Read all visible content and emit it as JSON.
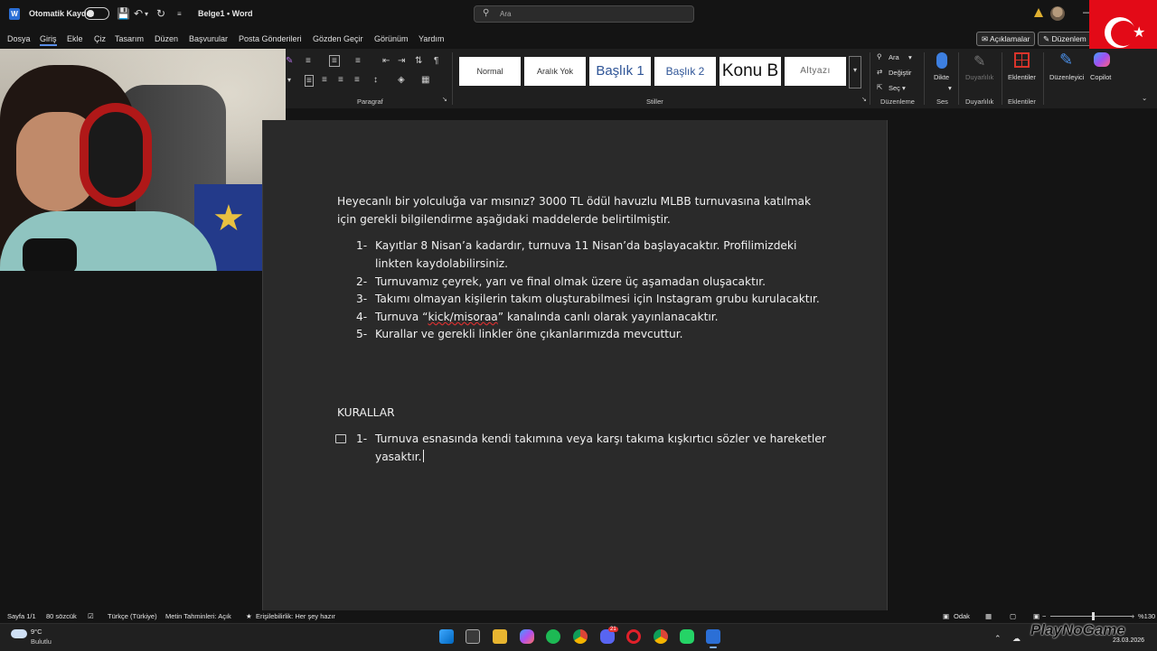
{
  "titlebar": {
    "autosave_label": "Otomatik Kaydet",
    "doc_title": "Belge1 • Word",
    "search_placeholder": "Ara",
    "search_icon": "search-icon",
    "warning_icon": "warning-icon"
  },
  "menu": {
    "items": [
      "Dosya",
      "Giriş",
      "Ekle",
      "Çiz",
      "Tasarım",
      "Düzen",
      "Başvurular",
      "Posta Gönderileri",
      "Gözden Geçir",
      "Görünüm",
      "Yardım"
    ],
    "active": "Giriş",
    "comments_label": "Açıklamalar",
    "editing_label": "Düzenlem"
  },
  "ribbon": {
    "paragraph_label": "Paragraf",
    "styles_label": "Stiller",
    "styles": [
      "Normal",
      "Aralık Yok",
      "Başlık 1",
      "Başlık 2",
      "Konu B",
      "Altyazı"
    ],
    "find_label": "Ara",
    "replace_label": "Değiştir",
    "select_label": "Seç",
    "editing_group_label": "Düzenleme",
    "dictate_label": "Dikte",
    "voice_group_label": "Ses",
    "sensitivity_label": "Duyarlılık",
    "sensitivity_group_label": "Duyarlılık",
    "addins_label": "Eklentiler",
    "addins_group_label": "Eklentiler",
    "editor_label": "Düzenleyici",
    "copilot_label": "Copilot",
    "accent_color": "#2f5597"
  },
  "document": {
    "intro_line1": "Heyecanlı bir yolculuğa var mısınız? 3000 TL ödül havuzlu MLBB turnuvasına katılmak",
    "intro_line2": "için gerekli bilgilendirme aşağıdaki maddelerde belirtilmiştir.",
    "list": [
      {
        "num": "1-",
        "line1": "Kayıtlar 8 Nisan’a kadardır, turnuva 11 Nisan’da başlayacaktır. Profilimizdeki",
        "line2": "linkten kaydolabilirsiniz."
      },
      {
        "num": "2-",
        "line1": "Turnuvamız çeyrek, yarı ve final olmak üzere üç aşamadan oluşacaktır."
      },
      {
        "num": "3-",
        "line1": "Takımı olmayan kişilerin takım oluşturabilmesi için Instagram grubu kurulacaktır."
      },
      {
        "num": "4-",
        "line1_pre": "Turnuva “",
        "line1_squiggle": "kick/misoraa",
        "line1_post": "” kanalında canlı olarak yayınlanacaktır."
      },
      {
        "num": "5-",
        "line1": "Kurallar ve gerekli linkler öne çıkanlarımızda mevcuttur."
      }
    ],
    "rules_heading": "KURALLAR",
    "rules": [
      {
        "num": "1-",
        "line1": "Turnuva esnasında kendi takımına veya karşı takıma kışkırtıcı sözler ve hareketler",
        "line2": "yasaktır."
      }
    ]
  },
  "status": {
    "page": "Sayfa 1/1",
    "words": "80 sözcük",
    "language": "Türkçe (Türkiye)",
    "predictions": "Metin Tahminleri: Açık",
    "accessibility": "Erişilebilirlik: Her şey hazır",
    "focus": "Odak",
    "zoom": "%130",
    "zoom_level_percent": 130
  },
  "taskbar": {
    "temp": "9°C",
    "weather": "Bulutlu",
    "date": "23.03.2026",
    "apps": [
      "windows-start",
      "task-view",
      "file-explorer",
      "copilot-app",
      "spotify",
      "chrome",
      "discord",
      "opera",
      "chrome-alt",
      "whatsapp",
      "word"
    ],
    "discord_badge": "21"
  },
  "watermark": "PlayNoGame"
}
